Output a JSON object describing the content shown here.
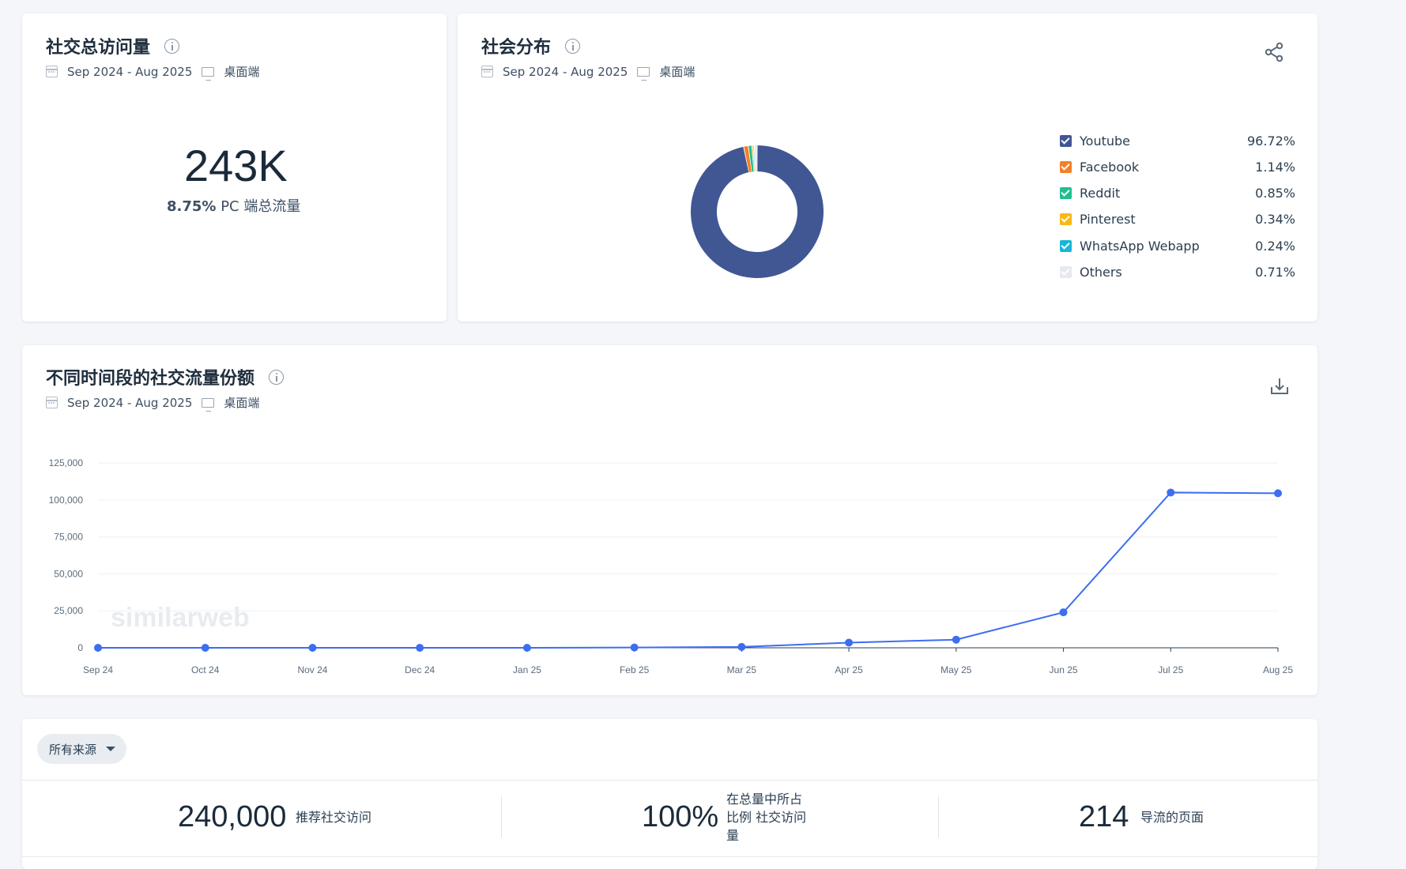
{
  "total_visits": {
    "title": "社交总访问量",
    "date_range": "Sep 2024 - Aug 2025",
    "device": "桌面端",
    "value": "243K",
    "share_percent": "8.75%",
    "share_label": "PC 端总流量"
  },
  "distribution": {
    "title": "社会分布",
    "date_range": "Sep 2024 - Aug 2025",
    "device": "桌面端",
    "legend": [
      {
        "name": "Youtube",
        "value": "96.72%",
        "color": "#415794"
      },
      {
        "name": "Facebook",
        "value": "1.14%",
        "color": "#f57f26"
      },
      {
        "name": "Reddit",
        "value": "0.85%",
        "color": "#1fbf8f"
      },
      {
        "name": "Pinterest",
        "value": "0.34%",
        "color": "#f9b814"
      },
      {
        "name": "WhatsApp Webapp",
        "value": "0.24%",
        "color": "#18b6d8"
      },
      {
        "name": "Others",
        "value": "0.71%",
        "color": "#e6e9ee"
      }
    ]
  },
  "trend": {
    "title": "不同时间段的社交流量份额",
    "date_range": "Sep 2024 - Aug 2025",
    "device": "桌面端",
    "watermark": "similarweb"
  },
  "chart_data": [
    {
      "type": "pie",
      "categories": [
        "Youtube",
        "Facebook",
        "Reddit",
        "Pinterest",
        "WhatsApp Webapp",
        "Others"
      ],
      "values": [
        96.72,
        1.14,
        0.85,
        0.34,
        0.24,
        0.71
      ],
      "colors": [
        "#415794",
        "#f57f26",
        "#1fbf8f",
        "#f9b814",
        "#18b6d8",
        "#e6e9ee"
      ],
      "donut": true,
      "legend": "right"
    },
    {
      "type": "line",
      "x": [
        "Sep 24",
        "Oct 24",
        "Nov 24",
        "Dec 24",
        "Jan 25",
        "Feb 25",
        "Mar 25",
        "Apr 25",
        "May 25",
        "Jun 25",
        "Jul 25",
        "Aug 25"
      ],
      "values": [
        0,
        0,
        0,
        0,
        0,
        200,
        600,
        3500,
        5500,
        24000,
        105000,
        104500
      ],
      "ylim": [
        0,
        125000
      ],
      "yticks": [
        "0",
        "25,000",
        "50,000",
        "75,000",
        "100,000",
        "125,000"
      ],
      "ytick_values": [
        0,
        25000,
        50000,
        75000,
        100000,
        125000
      ],
      "grid": true,
      "color": "#3d6ef0"
    }
  ],
  "filter": {
    "label": "所有来源"
  },
  "stats": [
    {
      "value": "240,000",
      "label": "推荐社交访问"
    },
    {
      "value": "100%",
      "label_lines": [
        "在总量中所占",
        "比例 社交访问",
        "量"
      ]
    },
    {
      "value": "214",
      "label": "导流的页面"
    }
  ]
}
